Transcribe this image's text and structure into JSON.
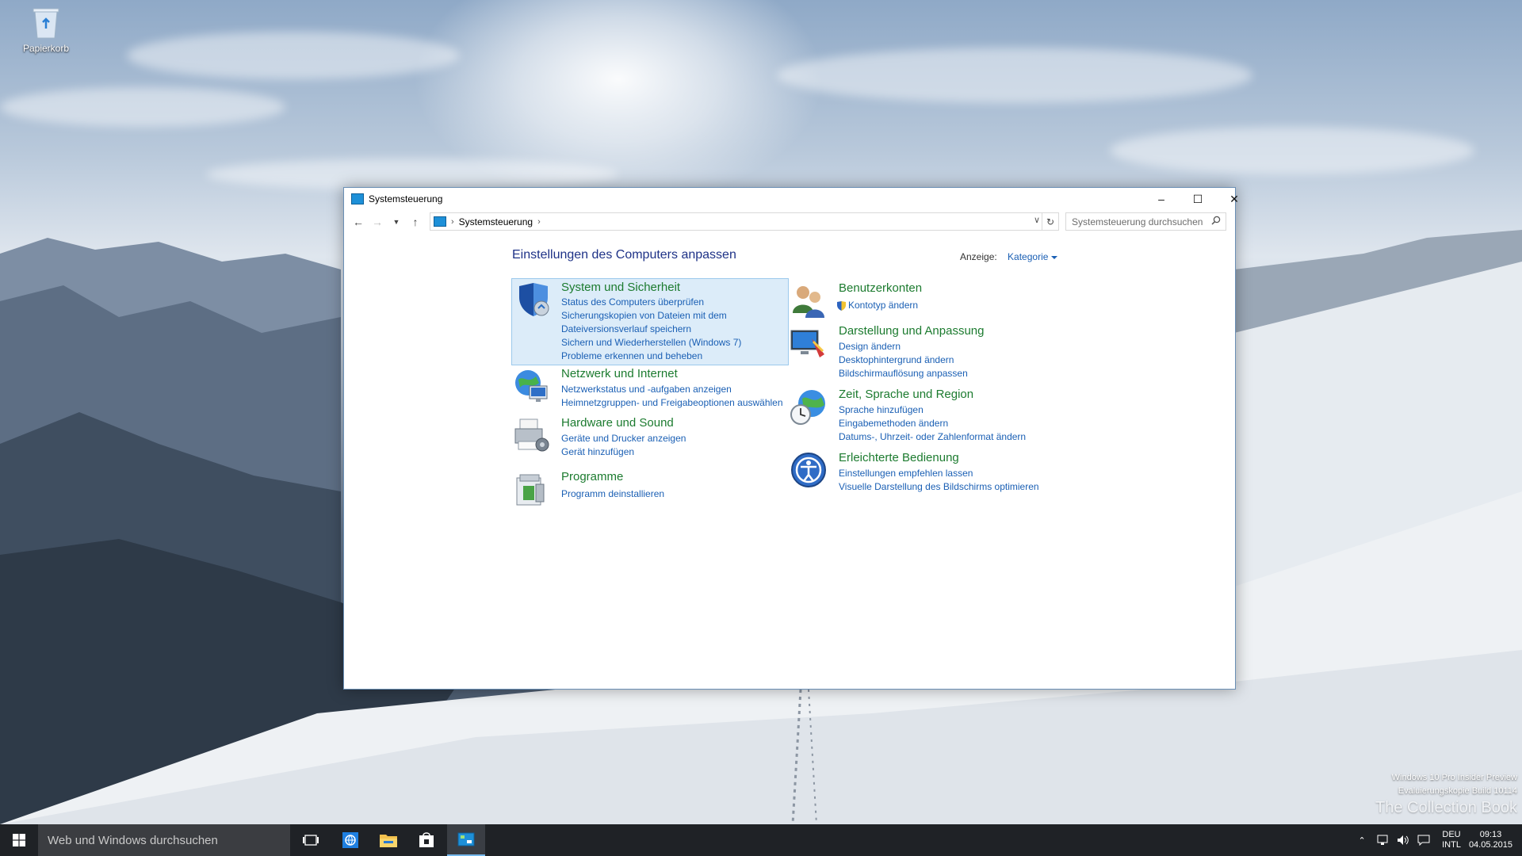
{
  "desktop": {
    "recycle_bin_label": "Papierkorb"
  },
  "watermark": {
    "line1": "Windows 10 Pro Insider Preview",
    "line2": "Evaluierungskopie Build 10114",
    "line3": "The Collection Book"
  },
  "window": {
    "title": "Systemsteuerung",
    "address": {
      "crumb": "Systemsteuerung"
    },
    "search_placeholder": "Systemsteuerung durchsuchen",
    "heading": "Einstellungen des Computers anpassen",
    "view_label": "Anzeige:",
    "view_value": "Kategorie",
    "categories_left": [
      {
        "title": "System und Sicherheit",
        "links": [
          "Status des Computers überprüfen",
          "Sicherungskopien von Dateien mit dem",
          "Dateiversionsverlauf speichern",
          "Sichern und Wiederherstellen (Windows 7)",
          "Probleme erkennen und beheben"
        ]
      },
      {
        "title": "Netzwerk und Internet",
        "links": [
          "Netzwerkstatus und -aufgaben anzeigen",
          "Heimnetzgruppen- und Freigabeoptionen auswählen"
        ]
      },
      {
        "title": "Hardware und Sound",
        "links": [
          "Geräte und Drucker anzeigen",
          "Gerät hinzufügen"
        ]
      },
      {
        "title": "Programme",
        "links": [
          "Programm deinstallieren"
        ]
      }
    ],
    "categories_right": [
      {
        "title": "Benutzerkonten",
        "links": [
          "Kontotyp ändern"
        ]
      },
      {
        "title": "Darstellung und Anpassung",
        "links": [
          "Design ändern",
          "Desktophintergrund ändern",
          "Bildschirmauflösung anpassen"
        ]
      },
      {
        "title": "Zeit, Sprache und Region",
        "links": [
          "Sprache hinzufügen",
          "Eingabemethoden ändern",
          "Datums-, Uhrzeit- oder Zahlenformat ändern"
        ]
      },
      {
        "title": "Erleichterte Bedienung",
        "links": [
          "Einstellungen empfehlen lassen",
          "Visuelle Darstellung des Bildschirms optimieren"
        ]
      }
    ]
  },
  "taskbar": {
    "search_text": "Web und Windows durchsuchen",
    "lang_top": "DEU",
    "lang_bottom": "INTL",
    "time": "09:13",
    "date": "04.05.2015"
  }
}
